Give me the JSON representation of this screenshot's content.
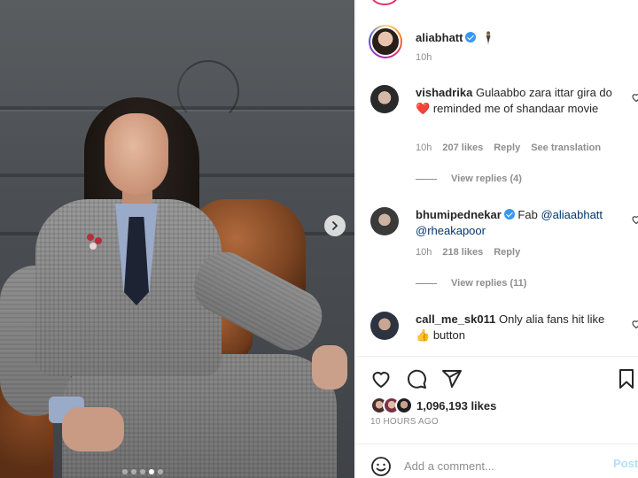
{
  "post": {
    "author": "aliabhatt",
    "author_emoji": "🕴",
    "time": "10h",
    "carousel": {
      "total_slides": 5,
      "active_index": 3
    }
  },
  "comments": [
    {
      "username": "vishadrika",
      "text_before": "Gulaabbo zara ittar gira do",
      "emoji": "❤️",
      "text_after": "reminded me of shandaar movie",
      "time": "10h",
      "likes": "207 likes",
      "reply": "Reply",
      "translate": "See translation",
      "view_replies": "View replies (4)",
      "avatar_color": "#2a2a2a"
    },
    {
      "username": "bhumipednekar",
      "verified": true,
      "text": "Fab",
      "mention1": "@aliaabhatt",
      "mention2": "@rheakapoor",
      "time": "10h",
      "likes": "218 likes",
      "reply": "Reply",
      "view_replies": "View replies (11)",
      "avatar_color": "#3a3a3a"
    },
    {
      "username": "call_me_sk011",
      "text": "Only alia fans hit like",
      "emoji": "👍",
      "text_after": "button",
      "avatar_color": "#2e3340"
    }
  ],
  "footer": {
    "likes": "1,096,193 likes",
    "ago": "10 HOURS AGO",
    "comment_placeholder": "Add a comment...",
    "post_label": "Post"
  },
  "colors": {
    "link": "#00376b",
    "verified": "#3897f0",
    "post_button": "#b2dffc",
    "muted": "#8e8e8e"
  }
}
